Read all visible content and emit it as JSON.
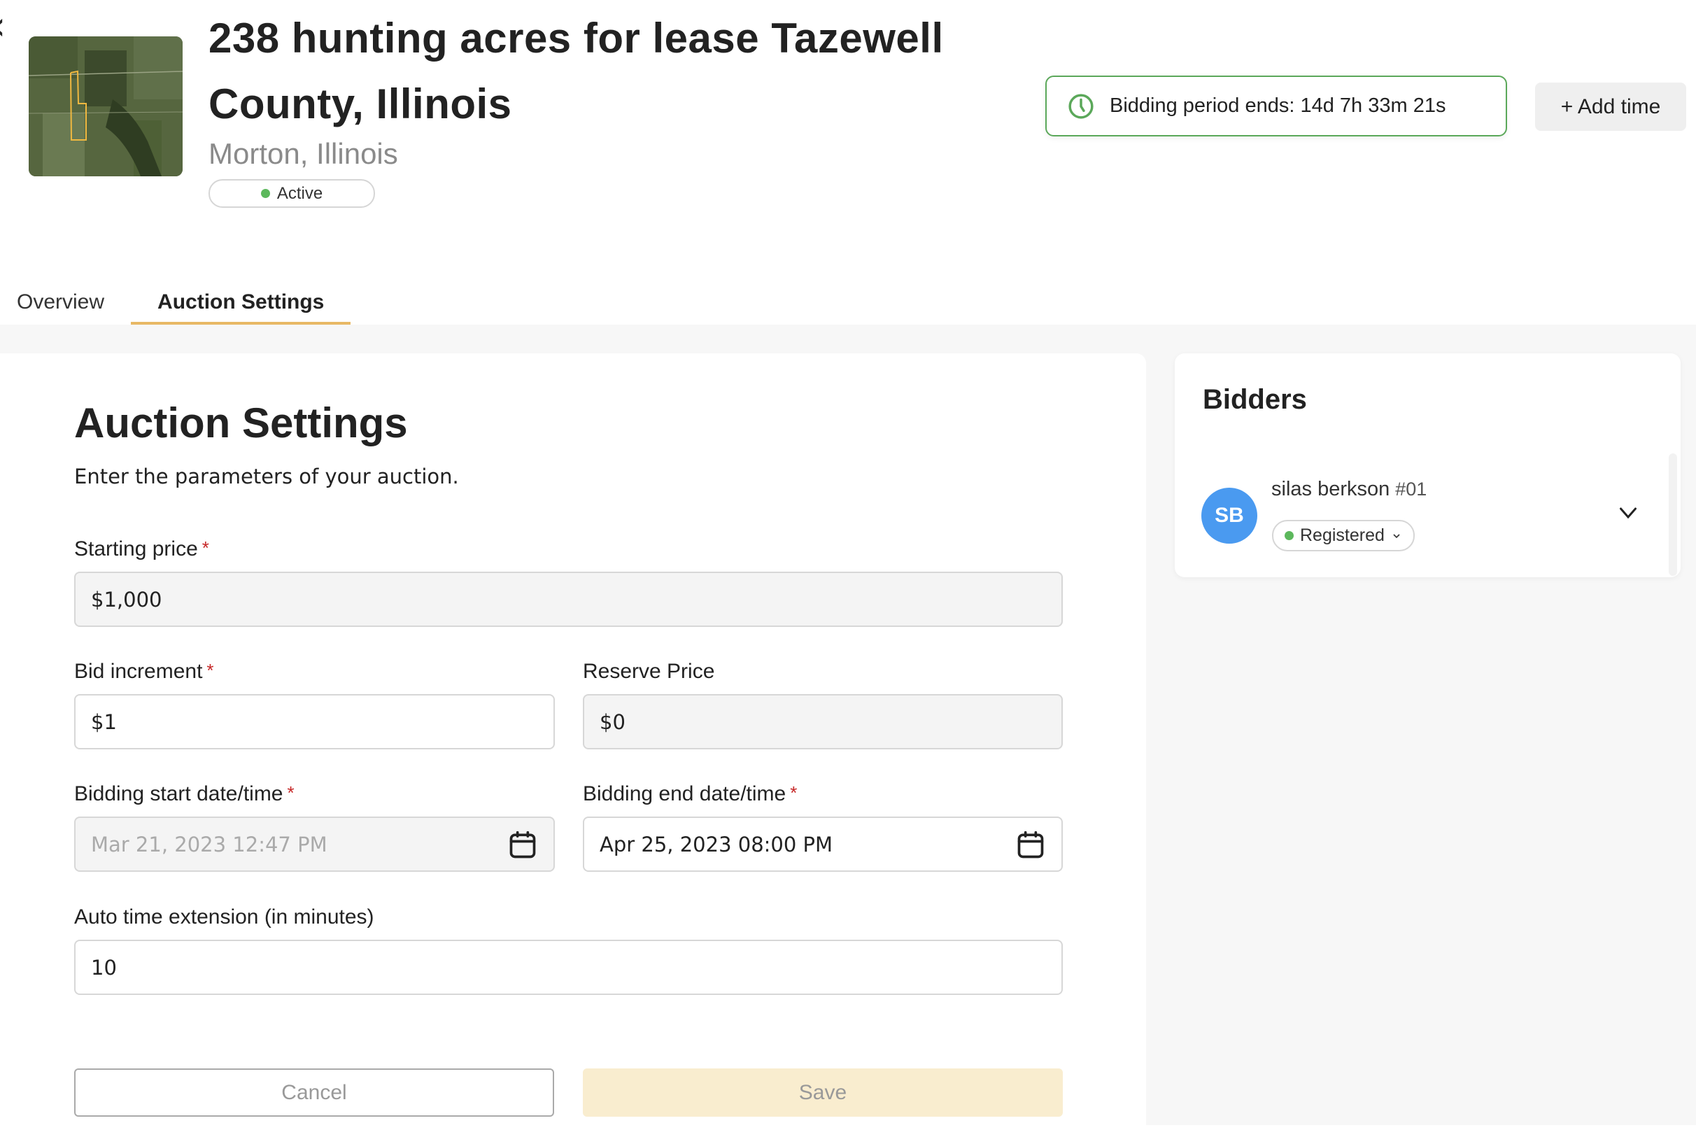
{
  "header": {
    "back_icon": "chevron-left-icon",
    "thumbnail_alt": "aerial map of property",
    "title": "238 hunting acres for lease Tazewell County, Illinois",
    "location": "Morton, Illinois",
    "status": "Active",
    "timer_text": "Bidding period ends: 14d 7h 33m 21s",
    "add_time_label": "+ Add time"
  },
  "tabs": [
    {
      "label": "Overview",
      "active": false
    },
    {
      "label": "Auction Settings",
      "active": true
    }
  ],
  "form": {
    "heading": "Auction Settings",
    "subtitle": "Enter the parameters of your auction.",
    "fields": {
      "starting_price": {
        "label": "Starting price",
        "required": true,
        "value": "$1,000",
        "disabled": true
      },
      "bid_increment": {
        "label": "Bid increment",
        "required": true,
        "value": "$1",
        "disabled": false
      },
      "reserve_price": {
        "label": "Reserve Price",
        "required": false,
        "value": "$0",
        "disabled": true
      },
      "start_datetime": {
        "label": "Bidding start date/time",
        "required": true,
        "value": "Mar 21, 2023 12:47 PM",
        "disabled": true
      },
      "end_datetime": {
        "label": "Bidding end date/time",
        "required": true,
        "value": "Apr 25, 2023 08:00 PM",
        "disabled": false
      },
      "auto_extension": {
        "label": "Auto time extension (in minutes)",
        "required": false,
        "value": "10",
        "disabled": false
      }
    },
    "required_mark": "*",
    "cancel_label": "Cancel",
    "save_label": "Save"
  },
  "bidders": {
    "title": "Bidders",
    "items": [
      {
        "initials": "SB",
        "name": "silas berkson",
        "number": "#01",
        "status": "Registered"
      }
    ]
  },
  "colors": {
    "accent": "#e8b865",
    "success": "#5ba85a",
    "avatar": "#4a9af0",
    "required": "#c62828",
    "save_disabled_bg": "#f9edcf"
  }
}
